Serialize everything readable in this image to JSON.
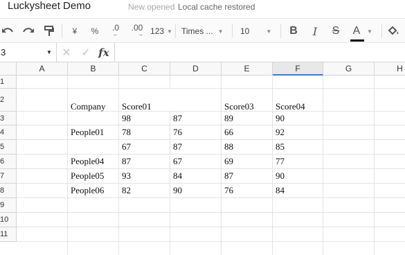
{
  "app": {
    "title": "Luckysheet Demo",
    "status_new": "New opened",
    "status_cache": "Local cache restored"
  },
  "toolbar": {
    "undo": "undo-icon",
    "redo": "redo-icon",
    "paint_format": "paint-format-icon",
    "currency": "¥",
    "percent": "%",
    "decrease_decimal": ".0",
    "increase_decimal": ".00",
    "number_format": "123",
    "font_family": "Times ...",
    "font_size": "10",
    "bold": "B",
    "italic": "I",
    "strikethrough": "S",
    "text_color": "A",
    "text_color_value": "#000000"
  },
  "formula_bar": {
    "cell_ref": "3",
    "cancel": "✕",
    "confirm": "✓",
    "fx": "fx",
    "value": ""
  },
  "grid": {
    "columns": [
      "A",
      "B",
      "C",
      "D",
      "E",
      "F",
      "G",
      "H"
    ],
    "selected_column": "F",
    "rows": [
      "1",
      "2",
      "3",
      "4",
      "5",
      "6",
      "7",
      "8",
      "9",
      "10",
      "11"
    ],
    "header_row": {
      "B": "Company",
      "C": "Score01",
      "E": "Score03",
      "F": "Score04"
    },
    "data_rows": [
      {
        "company": "",
        "c": "98",
        "d": "87",
        "e": "89",
        "f": "90"
      },
      {
        "company": "People01",
        "c": "78",
        "d": "76",
        "e": "66",
        "f": "92"
      },
      {
        "company": "",
        "c": "67",
        "d": "87",
        "e": "88",
        "f": "85"
      },
      {
        "company": "People04",
        "c": "87",
        "d": "67",
        "e": "69",
        "f": "77"
      },
      {
        "company": "People05",
        "c": "93",
        "d": "84",
        "e": "87",
        "f": "90"
      },
      {
        "company": "People06",
        "c": "82",
        "d": "90",
        "e": "76",
        "f": "84"
      }
    ]
  }
}
